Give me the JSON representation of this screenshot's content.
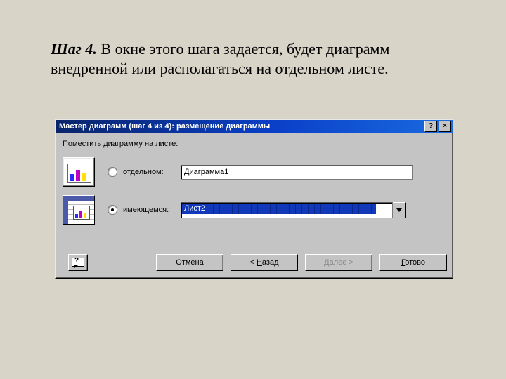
{
  "caption": {
    "bold": "Шаг 4.",
    "rest": " В окне этого шага задается, будет диаграмм внедренной или располагаться на отдельном листе."
  },
  "dialog": {
    "title": "Мастер диаграмм (шаг 4 из 4): размещение диаграммы",
    "help_btn": "?",
    "close_btn": "×",
    "prompt": "Поместить диаграмму на листе:",
    "options": {
      "new_sheet": {
        "label": "отдельном:",
        "value": "Диаграмма1",
        "checked": false
      },
      "existing": {
        "label": "имеющемся:",
        "value": "Лист2",
        "checked": true
      }
    },
    "buttons": {
      "help_icon": "?",
      "cancel": "Отмена",
      "back_full": "< Назад",
      "back_prefix": "< ",
      "back_u": "Н",
      "back_rest": "азад",
      "next_full": "Далее >",
      "next_u": "Д",
      "next_rest": "алее >",
      "finish_full": "Готово",
      "finish_u": "Г",
      "finish_rest": "отово"
    }
  }
}
